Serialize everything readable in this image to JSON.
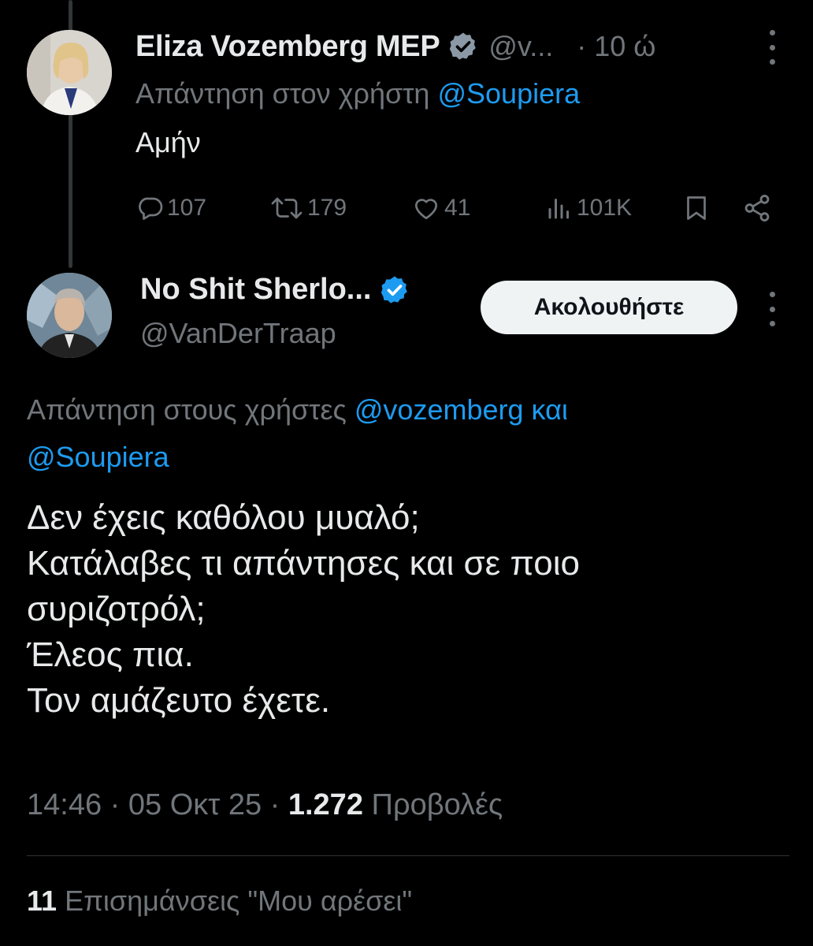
{
  "tweet1": {
    "display_name": "Eliza Vozemberg MEP",
    "handle": "@v...",
    "time": "· 10 ώ",
    "reply_prefix": "Απάντηση στον χρήστη",
    "reply_mention": "@Soupiera",
    "text": "Αμήν",
    "actions": {
      "replies": "107",
      "retweets": "179",
      "likes": "41",
      "views": "101K"
    }
  },
  "tweet2": {
    "display_name": "No Shit Sherlo...",
    "handle": "@VanDerTraap",
    "follow_label": "Ακολουθήστε",
    "reply_prefix": "Απάντηση στους χρήστες",
    "reply_mention1": "@vozemberg",
    "reply_conj": "και",
    "reply_mention2": "@Soupiera",
    "lines": [
      "Δεν έχεις καθόλου μυαλό;",
      "Κατάλαβες τι απάντησες και σε ποιο",
      "συριζοτρόλ;",
      "Έλεος πια.",
      "Τον αμάζευτο έχετε."
    ],
    "timestamp": "14:46 · 05 Οκτ 25 ·",
    "views_count": "1.272",
    "views_label": "Προβολές",
    "likes_count": "11",
    "likes_label": "Επισημάνσεις \"Μου αρέσει\""
  },
  "colors": {
    "background": "#000000",
    "text": "#e7e9ea",
    "secondary": "#71767b",
    "accent": "#1d9bf0"
  },
  "icons": [
    "reply-icon",
    "retweet-icon",
    "like-icon",
    "views-icon",
    "bookmark-icon",
    "share-icon",
    "verified-badge-icon",
    "more-icon"
  ]
}
